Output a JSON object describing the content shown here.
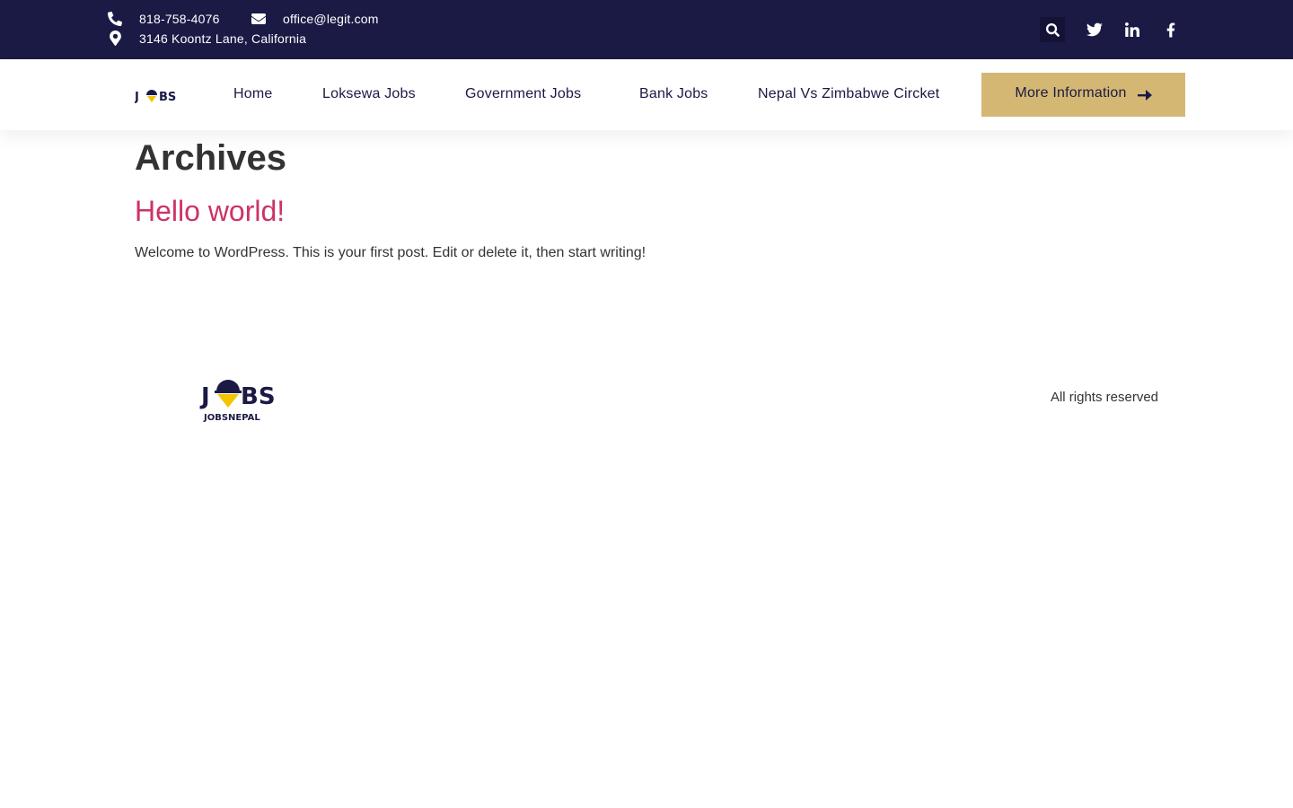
{
  "topbar": {
    "phone": "818-758-4076",
    "email": "office@legit.com",
    "address": "3146 Koontz Lane, California",
    "icons": [
      "phone-icon",
      "envelope-icon",
      "map-marker-icon",
      "search-icon",
      "twitter-icon",
      "linkedin-icon",
      "facebook-icon"
    ]
  },
  "header": {
    "logo_text": "JOBS",
    "nav": [
      {
        "label": "Home"
      },
      {
        "label": "Loksewa Jobs"
      },
      {
        "label": "Government Jobs"
      },
      {
        "label": "Bank Jobs"
      },
      {
        "label": "Nepal Vs Zimbabwe Circket"
      }
    ],
    "cta_label": "More Information"
  },
  "main": {
    "page_title": "Archives",
    "post_title": "Hello world!",
    "post_excerpt": "Welcome to WordPress. This is your first post. Edit or delete it, then start writing!"
  },
  "footer": {
    "logo_text": "JOBS",
    "logo_subtext": "JOBSNEPAL",
    "rights": "All rights reserved"
  },
  "colors": {
    "topbar_bg": "#1b1a45",
    "accent": "#d4b773",
    "link": "#cc3366",
    "nav_text": "#1b1a45"
  }
}
